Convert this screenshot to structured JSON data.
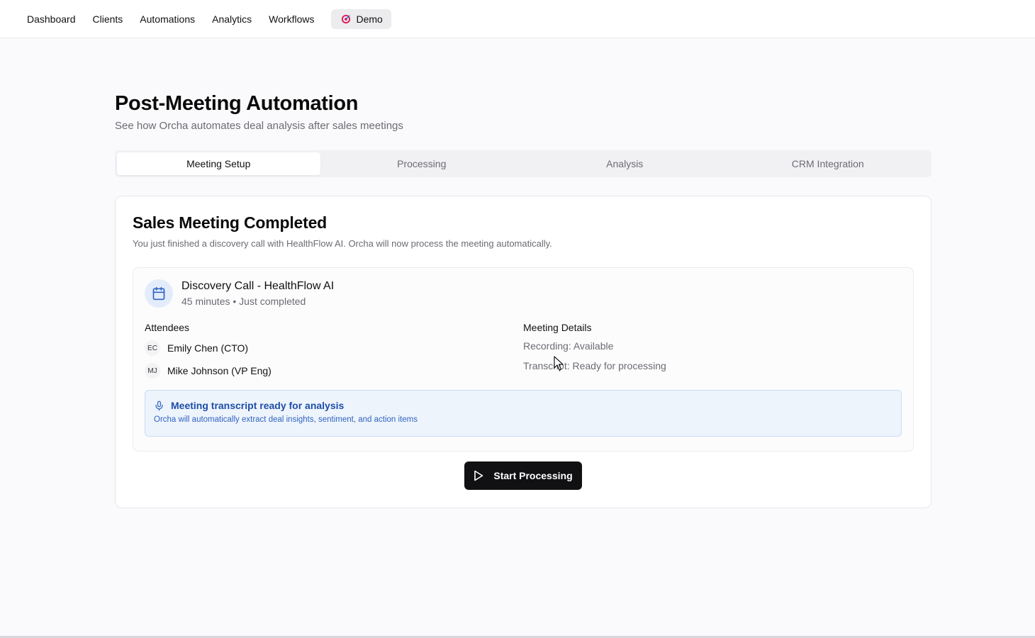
{
  "nav": {
    "items": [
      {
        "label": "Dashboard"
      },
      {
        "label": "Clients"
      },
      {
        "label": "Automations"
      },
      {
        "label": "Analytics"
      },
      {
        "label": "Workflows"
      }
    ],
    "demo_label": "Demo",
    "demo_icon": "target-icon"
  },
  "page": {
    "title": "Post-Meeting Automation",
    "subtitle": "See how Orcha automates deal analysis after sales meetings"
  },
  "tabs": [
    {
      "label": "Meeting Setup",
      "active": true
    },
    {
      "label": "Processing",
      "active": false
    },
    {
      "label": "Analysis",
      "active": false
    },
    {
      "label": "CRM Integration",
      "active": false
    }
  ],
  "card": {
    "title": "Sales Meeting Completed",
    "description": "You just finished a discovery call with HealthFlow AI. Orcha will now process the meeting automatically.",
    "meeting": {
      "icon": "calendar-icon",
      "name": "Discovery Call - HealthFlow AI",
      "meta": "45 minutes • Just completed"
    },
    "attendees_title": "Attendees",
    "attendees": [
      {
        "initials": "EC",
        "name": "Emily Chen (CTO)"
      },
      {
        "initials": "MJ",
        "name": "Mike Johnson (VP Eng)"
      }
    ],
    "details_title": "Meeting Details",
    "details": [
      {
        "text": "Recording: Available"
      },
      {
        "text": "Transcript: Ready for processing"
      }
    ],
    "notice": {
      "icon": "microphone-icon",
      "title": "Meeting transcript ready for analysis",
      "description": "Orcha will automatically extract deal insights, sentiment, and action items"
    },
    "start_button": {
      "label": "Start Processing",
      "icon": "play-icon"
    }
  },
  "colors": {
    "accent_blue": "#2f63c2",
    "notice_bg": "#eef4fc",
    "button_bg": "#111114",
    "demo_icon_red": "#e0245e"
  }
}
